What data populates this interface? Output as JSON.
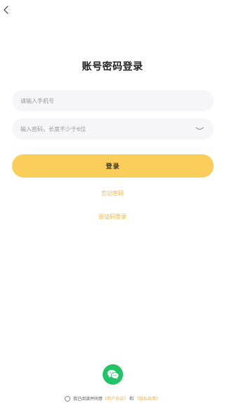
{
  "header": {
    "back_icon": "chevron-left-icon"
  },
  "page": {
    "title": "账号密码登录"
  },
  "form": {
    "phone_placeholder": "请输入手机号",
    "password_placeholder": "输入密码，长度不少于6位",
    "password_toggle_icon": "eye-closed-icon",
    "login_label": "登录"
  },
  "links": {
    "forgot_password": "忘记密码",
    "code_login": "验证码登录"
  },
  "social": {
    "wechat_icon": "wechat-icon"
  },
  "agreement": {
    "prefix": "我已阅读并同意",
    "user_agreement": "《用户协议》",
    "conjunction": "和",
    "privacy_policy": "《隐私政策》"
  },
  "colors": {
    "accent": "#fbcd5a",
    "link": "#f5b13a",
    "wechat": "#21c567",
    "field_bg": "#f6f6f8"
  }
}
